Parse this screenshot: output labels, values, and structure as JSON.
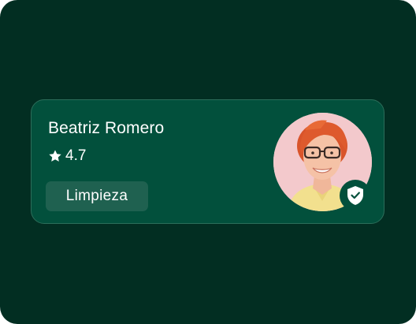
{
  "profile": {
    "name": "Beatriz Romero",
    "rating": "4.7",
    "category": "Limpieza"
  },
  "icons": {
    "rating": "star-icon",
    "verified": "shield-check-icon"
  },
  "colors": {
    "background": "#022e22",
    "card": "#02503c",
    "card_border": "#2c6e5a",
    "tag": "#1f6150",
    "avatar_bg": "#f3c9cc",
    "text": "#ffffff"
  }
}
